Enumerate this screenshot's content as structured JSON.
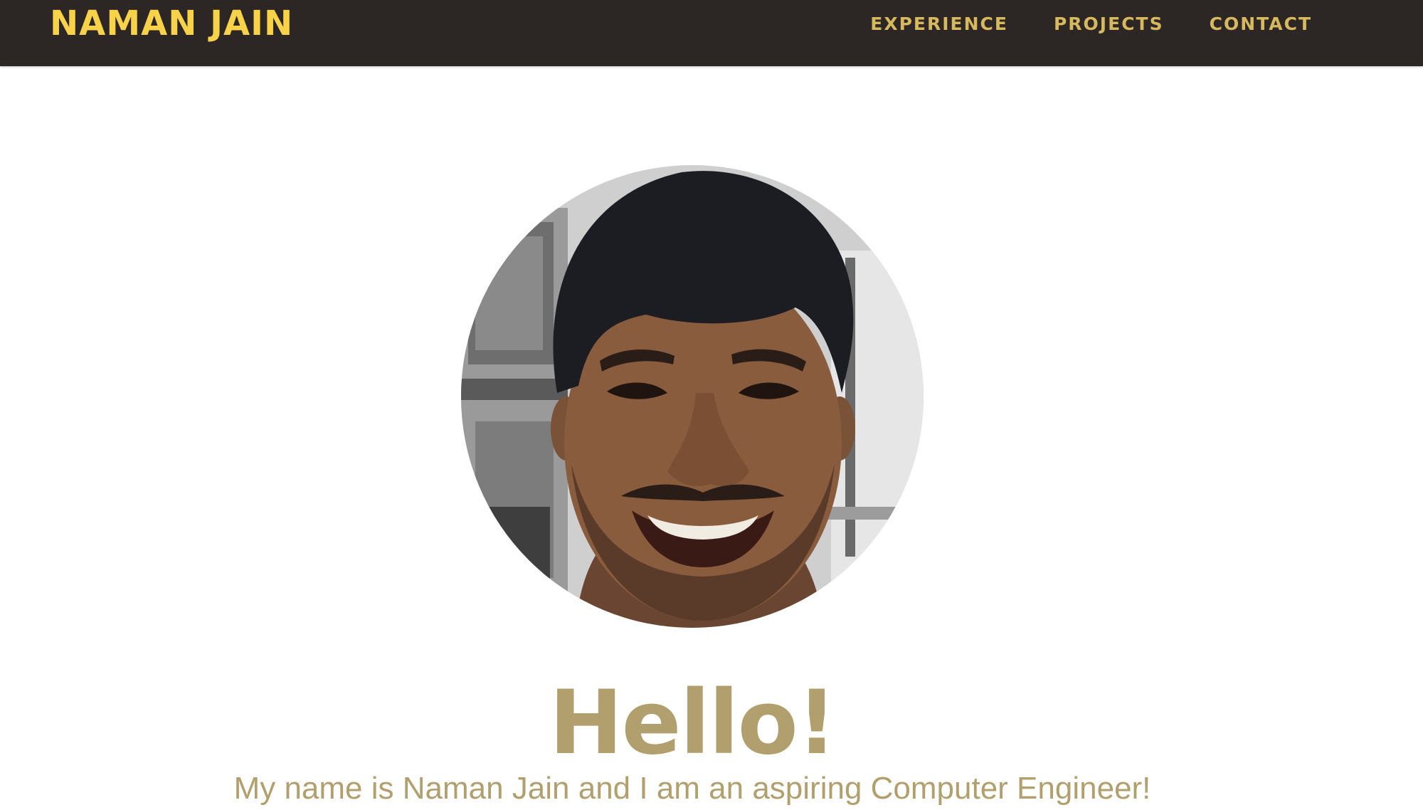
{
  "navbar": {
    "brand": "NAMAN JAIN",
    "links": [
      {
        "label": "EXPERIENCE"
      },
      {
        "label": "PROJECTS"
      },
      {
        "label": "CONTACT"
      }
    ]
  },
  "hero": {
    "greeting": "Hello!",
    "intro": "My name is Naman Jain and I am an aspiring Computer Engineer!",
    "avatar_alt": "profile photo"
  },
  "colors": {
    "navbar_bg": "#2c2625",
    "brand": "#f8d34a",
    "nav_link": "#d6b85f",
    "hero_text": "#b1a06e"
  }
}
